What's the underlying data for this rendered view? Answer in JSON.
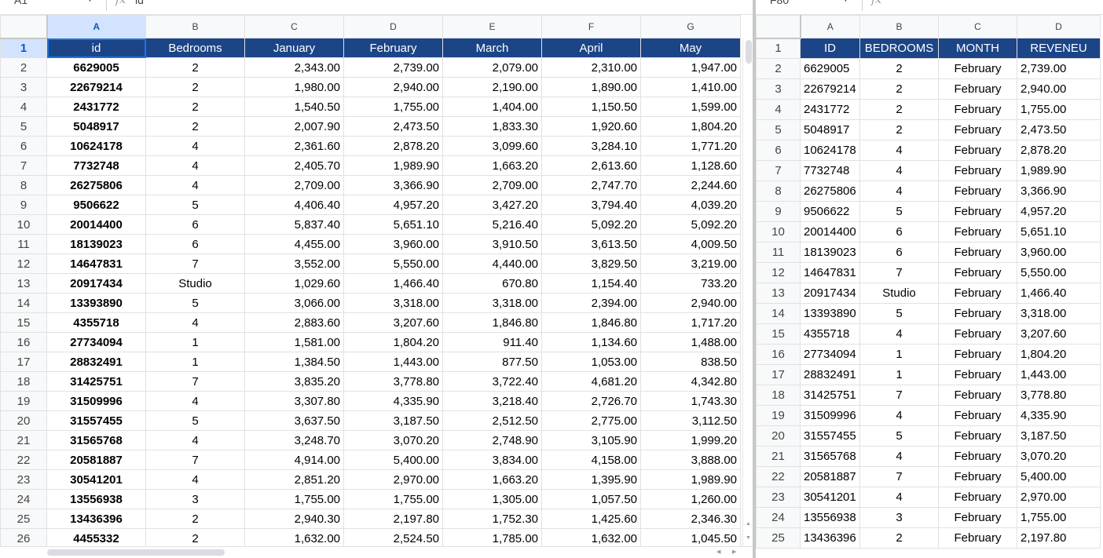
{
  "left": {
    "name_box": "A1",
    "formula_value": "id",
    "columns": [
      "A",
      "B",
      "C",
      "D",
      "E",
      "F",
      "G"
    ],
    "header": [
      "id",
      "Bedrooms",
      "January",
      "February",
      "March",
      "April",
      "May"
    ],
    "rows": [
      {
        "n": "2",
        "id": "6629005",
        "bed": "2",
        "jan": "2,343.00",
        "feb": "2,739.00",
        "mar": "2,079.00",
        "apr": "2,310.00",
        "may": "1,947.00"
      },
      {
        "n": "3",
        "id": "22679214",
        "bed": "2",
        "jan": "1,980.00",
        "feb": "2,940.00",
        "mar": "2,190.00",
        "apr": "1,890.00",
        "may": "1,410.00"
      },
      {
        "n": "4",
        "id": "2431772",
        "bed": "2",
        "jan": "1,540.50",
        "feb": "1,755.00",
        "mar": "1,404.00",
        "apr": "1,150.50",
        "may": "1,599.00"
      },
      {
        "n": "5",
        "id": "5048917",
        "bed": "2",
        "jan": "2,007.90",
        "feb": "2,473.50",
        "mar": "1,833.30",
        "apr": "1,920.60",
        "may": "1,804.20"
      },
      {
        "n": "6",
        "id": "10624178",
        "bed": "4",
        "jan": "2,361.60",
        "feb": "2,878.20",
        "mar": "3,099.60",
        "apr": "3,284.10",
        "may": "1,771.20"
      },
      {
        "n": "7",
        "id": "7732748",
        "bed": "4",
        "jan": "2,405.70",
        "feb": "1,989.90",
        "mar": "1,663.20",
        "apr": "2,613.60",
        "may": "1,128.60"
      },
      {
        "n": "8",
        "id": "26275806",
        "bed": "4",
        "jan": "2,709.00",
        "feb": "3,366.90",
        "mar": "2,709.00",
        "apr": "2,747.70",
        "may": "2,244.60"
      },
      {
        "n": "9",
        "id": "9506622",
        "bed": "5",
        "jan": "4,406.40",
        "feb": "4,957.20",
        "mar": "3,427.20",
        "apr": "3,794.40",
        "may": "4,039.20"
      },
      {
        "n": "10",
        "id": "20014400",
        "bed": "6",
        "jan": "5,837.40",
        "feb": "5,651.10",
        "mar": "5,216.40",
        "apr": "5,092.20",
        "may": "5,092.20"
      },
      {
        "n": "11",
        "id": "18139023",
        "bed": "6",
        "jan": "4,455.00",
        "feb": "3,960.00",
        "mar": "3,910.50",
        "apr": "3,613.50",
        "may": "4,009.50"
      },
      {
        "n": "12",
        "id": "14647831",
        "bed": "7",
        "jan": "3,552.00",
        "feb": "5,550.00",
        "mar": "4,440.00",
        "apr": "3,829.50",
        "may": "3,219.00"
      },
      {
        "n": "13",
        "id": "20917434",
        "bed": "Studio",
        "jan": "1,029.60",
        "feb": "1,466.40",
        "mar": "670.80",
        "apr": "1,154.40",
        "may": "733.20"
      },
      {
        "n": "14",
        "id": "13393890",
        "bed": "5",
        "jan": "3,066.00",
        "feb": "3,318.00",
        "mar": "3,318.00",
        "apr": "2,394.00",
        "may": "2,940.00"
      },
      {
        "n": "15",
        "id": "4355718",
        "bed": "4",
        "jan": "2,883.60",
        "feb": "3,207.60",
        "mar": "1,846.80",
        "apr": "1,846.80",
        "may": "1,717.20"
      },
      {
        "n": "16",
        "id": "27734094",
        "bed": "1",
        "jan": "1,581.00",
        "feb": "1,804.20",
        "mar": "911.40",
        "apr": "1,134.60",
        "may": "1,488.00"
      },
      {
        "n": "17",
        "id": "28832491",
        "bed": "1",
        "jan": "1,384.50",
        "feb": "1,443.00",
        "mar": "877.50",
        "apr": "1,053.00",
        "may": "838.50"
      },
      {
        "n": "18",
        "id": "31425751",
        "bed": "7",
        "jan": "3,835.20",
        "feb": "3,778.80",
        "mar": "3,722.40",
        "apr": "4,681.20",
        "may": "4,342.80"
      },
      {
        "n": "19",
        "id": "31509996",
        "bed": "4",
        "jan": "3,307.80",
        "feb": "4,335.90",
        "mar": "3,218.40",
        "apr": "2,726.70",
        "may": "1,743.30"
      },
      {
        "n": "20",
        "id": "31557455",
        "bed": "5",
        "jan": "3,637.50",
        "feb": "3,187.50",
        "mar": "2,512.50",
        "apr": "2,775.00",
        "may": "3,112.50"
      },
      {
        "n": "21",
        "id": "31565768",
        "bed": "4",
        "jan": "3,248.70",
        "feb": "3,070.20",
        "mar": "2,748.90",
        "apr": "3,105.90",
        "may": "1,999.20"
      },
      {
        "n": "22",
        "id": "20581887",
        "bed": "7",
        "jan": "4,914.00",
        "feb": "5,400.00",
        "mar": "3,834.00",
        "apr": "4,158.00",
        "may": "3,888.00"
      },
      {
        "n": "23",
        "id": "30541201",
        "bed": "4",
        "jan": "2,851.20",
        "feb": "2,970.00",
        "mar": "1,663.20",
        "apr": "1,395.90",
        "may": "1,989.90"
      },
      {
        "n": "24",
        "id": "13556938",
        "bed": "3",
        "jan": "1,755.00",
        "feb": "1,755.00",
        "mar": "1,305.00",
        "apr": "1,057.50",
        "may": "1,260.00"
      },
      {
        "n": "25",
        "id": "13436396",
        "bed": "2",
        "jan": "2,940.30",
        "feb": "2,197.80",
        "mar": "1,752.30",
        "apr": "1,425.60",
        "may": "2,346.30"
      },
      {
        "n": "26",
        "id": "4455332",
        "bed": "2",
        "jan": "1,632.00",
        "feb": "2,524.50",
        "mar": "1,785.00",
        "apr": "1,632.00",
        "may": "1,045.50"
      }
    ]
  },
  "right": {
    "name_box": "F80",
    "columns": [
      "A",
      "B",
      "C",
      "D"
    ],
    "header": [
      "ID",
      "BEDROOMS",
      "MONTH",
      "REVENEU"
    ],
    "rows": [
      {
        "n": "2",
        "id": "6629005",
        "bed": "2",
        "month": "February",
        "rev": "2,739.00"
      },
      {
        "n": "3",
        "id": "22679214",
        "bed": "2",
        "month": "February",
        "rev": "2,940.00"
      },
      {
        "n": "4",
        "id": "2431772",
        "bed": "2",
        "month": "February",
        "rev": "1,755.00"
      },
      {
        "n": "5",
        "id": "5048917",
        "bed": "2",
        "month": "February",
        "rev": "2,473.50"
      },
      {
        "n": "6",
        "id": "10624178",
        "bed": "4",
        "month": "February",
        "rev": "2,878.20"
      },
      {
        "n": "7",
        "id": "7732748",
        "bed": "4",
        "month": "February",
        "rev": "1,989.90"
      },
      {
        "n": "8",
        "id": "26275806",
        "bed": "4",
        "month": "February",
        "rev": "3,366.90"
      },
      {
        "n": "9",
        "id": "9506622",
        "bed": "5",
        "month": "February",
        "rev": "4,957.20"
      },
      {
        "n": "10",
        "id": "20014400",
        "bed": "6",
        "month": "February",
        "rev": "5,651.10"
      },
      {
        "n": "11",
        "id": "18139023",
        "bed": "6",
        "month": "February",
        "rev": "3,960.00"
      },
      {
        "n": "12",
        "id": "14647831",
        "bed": "7",
        "month": "February",
        "rev": "5,550.00"
      },
      {
        "n": "13",
        "id": "20917434",
        "bed": "Studio",
        "month": "February",
        "rev": "1,466.40"
      },
      {
        "n": "14",
        "id": "13393890",
        "bed": "5",
        "month": "February",
        "rev": "3,318.00"
      },
      {
        "n": "15",
        "id": "4355718",
        "bed": "4",
        "month": "February",
        "rev": "3,207.60"
      },
      {
        "n": "16",
        "id": "27734094",
        "bed": "1",
        "month": "February",
        "rev": "1,804.20"
      },
      {
        "n": "17",
        "id": "28832491",
        "bed": "1",
        "month": "February",
        "rev": "1,443.00"
      },
      {
        "n": "18",
        "id": "31425751",
        "bed": "7",
        "month": "February",
        "rev": "3,778.80"
      },
      {
        "n": "19",
        "id": "31509996",
        "bed": "4",
        "month": "February",
        "rev": "4,335.90"
      },
      {
        "n": "20",
        "id": "31557455",
        "bed": "5",
        "month": "February",
        "rev": "3,187.50"
      },
      {
        "n": "21",
        "id": "31565768",
        "bed": "4",
        "month": "February",
        "rev": "3,070.20"
      },
      {
        "n": "22",
        "id": "20581887",
        "bed": "7",
        "month": "February",
        "rev": "5,400.00"
      },
      {
        "n": "23",
        "id": "30541201",
        "bed": "4",
        "month": "February",
        "rev": "2,970.00"
      },
      {
        "n": "24",
        "id": "13556938",
        "bed": "3",
        "month": "February",
        "rev": "1,755.00"
      },
      {
        "n": "25",
        "id": "13436396",
        "bed": "2",
        "month": "February",
        "rev": "2,197.80"
      }
    ]
  },
  "icons": {
    "fx": "function-fx-icon",
    "caret": "chevron-down-icon"
  },
  "colors": {
    "header_fill": "#1c4587",
    "active_header": "#d3e3fd",
    "selection": "#1a73e8"
  }
}
